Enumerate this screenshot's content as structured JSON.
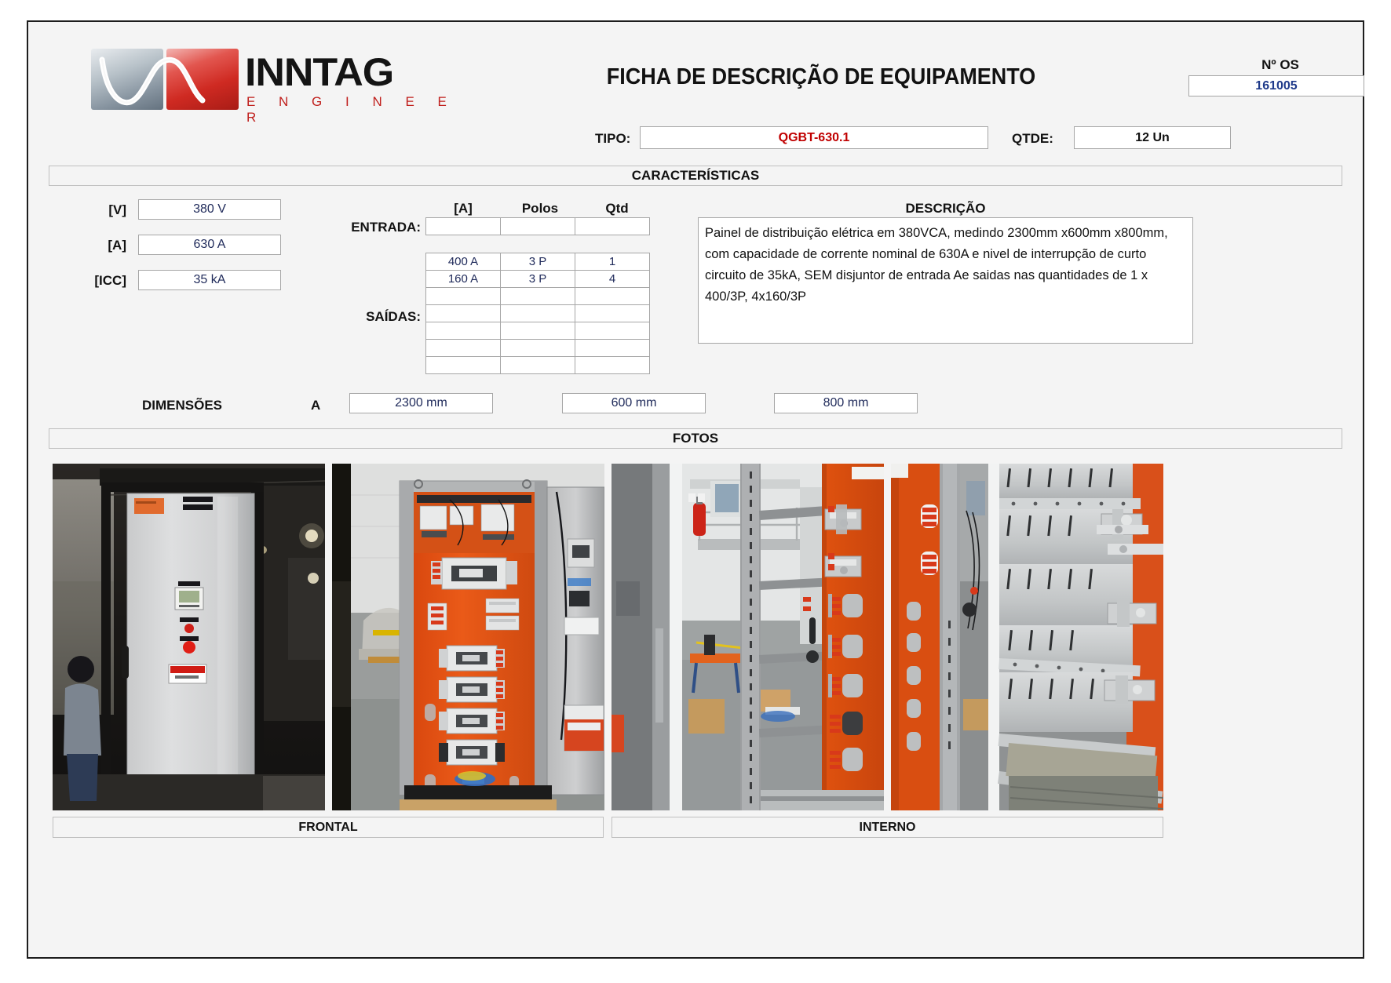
{
  "brand": {
    "name": "INNTAG",
    "subtitle": "E N G I N E E R"
  },
  "header": {
    "title": "FICHA DE DESCRIÇÃO DE EQUIPAMENTO",
    "os_label": "Nº OS",
    "os_value": "161005",
    "tipo_label": "TIPO:",
    "tipo_value": "QGBT-630.1",
    "qtde_label": "QTDE:",
    "qtde_value": "12 Un"
  },
  "sections": {
    "caracteristicas": "CARACTERÍSTICAS",
    "fotos": "FOTOS"
  },
  "specs": [
    {
      "label": "[V]",
      "value": "380 V"
    },
    {
      "label": "[A]",
      "value": "630 A"
    },
    {
      "label": "[ICC]",
      "value": "35 kA"
    }
  ],
  "breaker_table": {
    "headers": [
      "[A]",
      "Polos",
      "Qtd"
    ],
    "entrada_label": "ENTRADA:",
    "saidas_label": "SAÍDAS:",
    "entrada_row": {
      "amps": "",
      "polos": "",
      "qtd": ""
    },
    "saidas_rows": [
      {
        "amps": "400 A",
        "polos": "3 P",
        "qtd": "1"
      },
      {
        "amps": "160 A",
        "polos": "3 P",
        "qtd": "4"
      },
      {
        "amps": "",
        "polos": "",
        "qtd": ""
      },
      {
        "amps": "",
        "polos": "",
        "qtd": ""
      },
      {
        "amps": "",
        "polos": "",
        "qtd": ""
      },
      {
        "amps": "",
        "polos": "",
        "qtd": ""
      },
      {
        "amps": "",
        "polos": "",
        "qtd": ""
      }
    ]
  },
  "descricao": {
    "title": "DESCRIÇÃO",
    "text": "Painel de distribuição elétrica em 380VCA, medindo 2300mm x600mm x800mm, com capacidade de corrente nominal de 630A e nivel de interrupção de curto circuito de 35kA, SEM disjuntor de entrada Ae saidas nas quantidades de 1 x 400/3P, 4x160/3P"
  },
  "dimensoes": {
    "label": "DIMENSÕES",
    "axis": "A",
    "altura": "2300 mm",
    "largura": "600 mm",
    "profundidade": "800 mm"
  },
  "photos": [
    {
      "name": "photo-frontal-closed-panel"
    },
    {
      "name": "photo-frontal-open-panel"
    },
    {
      "name": "photo-interno-side-busbars"
    },
    {
      "name": "photo-interno-mounting-plates"
    }
  ],
  "captions": {
    "frontal": "FRONTAL",
    "interno": "INTERNO"
  },
  "colors": {
    "brand_red": "#c0201d",
    "value_blue": "#1f2a5a",
    "tipo_red": "#c00000",
    "os_blue": "#1f3a8a",
    "panel_orange": "#e8541f"
  }
}
